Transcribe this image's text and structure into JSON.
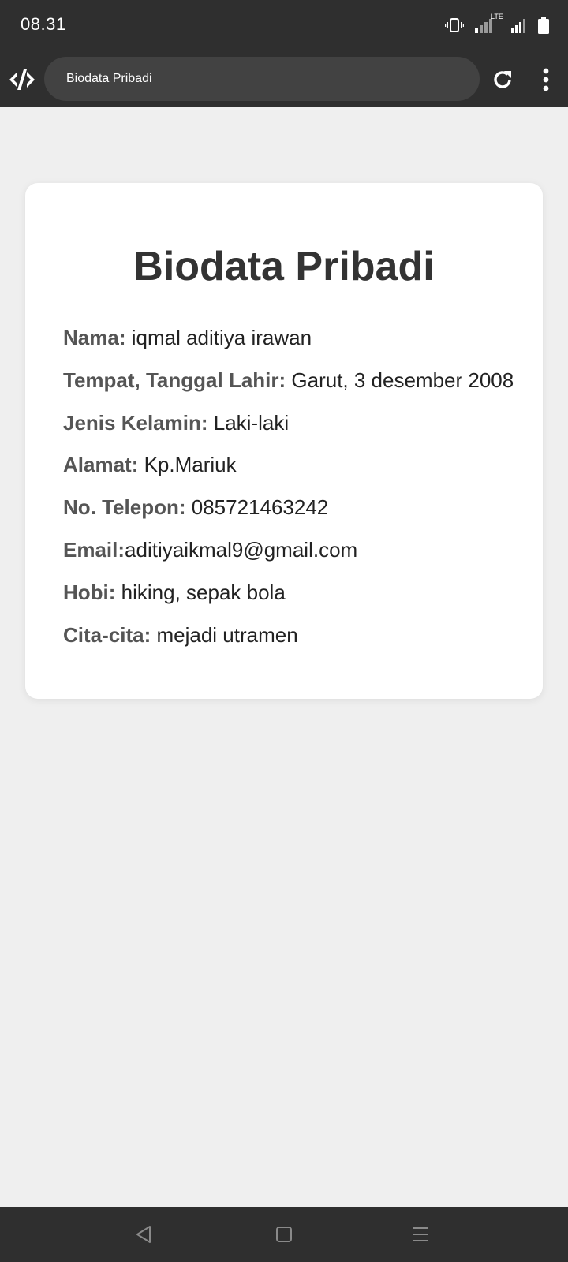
{
  "status_bar": {
    "time": "08.31",
    "network_label": "LTE"
  },
  "browser": {
    "url_title": "Biodata Pribadi"
  },
  "card": {
    "title": "Biodata Pribadi",
    "rows": [
      {
        "label": "Nama:",
        "value": " iqmal aditiya irawan"
      },
      {
        "label": "Tempat, Tanggal Lahir:",
        "value": " Garut, 3 desember 2008"
      },
      {
        "label": "Jenis Kelamin:",
        "value": " Laki-laki"
      },
      {
        "label": "Alamat:",
        "value": " Kp.Mariuk"
      },
      {
        "label": "No. Telepon:",
        "value": " 085721463242"
      },
      {
        "label": "Email:",
        "value": "aditiyaikmal9@gmail.com"
      },
      {
        "label": "Hobi:",
        "value": " hiking, sepak bola"
      },
      {
        "label": "Cita-cita:",
        "value": " mejadi utramen"
      }
    ]
  },
  "icons": {
    "status": [
      "vibrate-icon",
      "signal-icon",
      "signal-icon",
      "battery-icon"
    ],
    "toolbar": [
      "app-logo-icon",
      "reload-icon",
      "more-vert-icon"
    ],
    "nav": [
      "back-icon",
      "home-icon",
      "recents-icon"
    ]
  },
  "colors": {
    "bars": "#2f2f2f",
    "url_bar": "#424242",
    "page_background": "#efefef",
    "card_background": "#ffffff",
    "title": "#333333",
    "label": "#555555",
    "value": "#222222"
  }
}
